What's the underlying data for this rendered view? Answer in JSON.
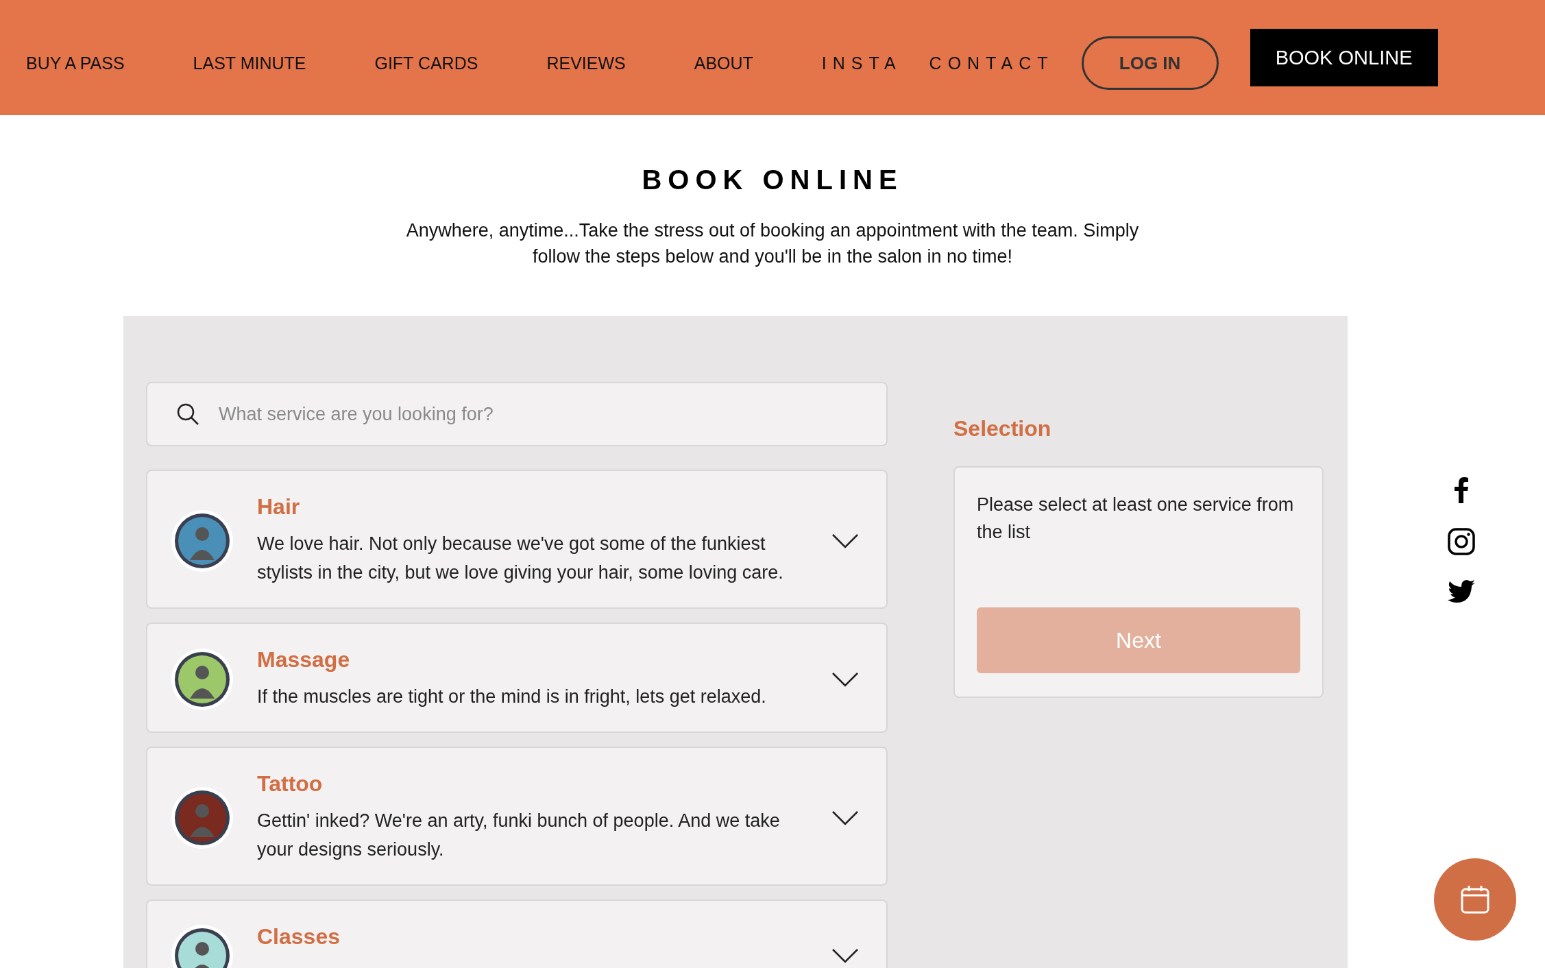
{
  "nav": {
    "links": [
      {
        "label": "BUY A PASS",
        "kind": "plain"
      },
      {
        "label": "LAST MINUTE",
        "kind": "plain"
      },
      {
        "label": "GIFT CARDS",
        "kind": "plain"
      },
      {
        "label": "REVIEWS",
        "kind": "plain"
      },
      {
        "label": "ABOUT",
        "kind": "plain"
      },
      {
        "label": "INSTA",
        "kind": "spaced"
      },
      {
        "label": "CONTACT",
        "kind": "spaced"
      }
    ],
    "login": "LOG IN",
    "book": "BOOK ONLINE"
  },
  "heading": "BOOK ONLINE",
  "intro": "Anywhere, anytime...Take the stress out of booking an appointment with the team. Simply follow the steps below and you'll be in the salon in no time!",
  "search": {
    "placeholder": "What service are you looking for?"
  },
  "services": [
    {
      "name": "Hair",
      "description": "We love hair. Not only because we've got some of the funkiest stylists in the city, but we love giving your hair, some loving care.",
      "color": "#4a8fb8"
    },
    {
      "name": "Massage",
      "description": "If the muscles are tight or the mind is in fright, lets get relaxed.",
      "color": "#9cc86a"
    },
    {
      "name": "Tattoo",
      "description": "Gettin' inked? We're an arty, funki bunch of people. And we take your designs seriously.",
      "color": "#7a2a1e"
    },
    {
      "name": "Classes",
      "color": "#a8dcd8"
    }
  ],
  "selection": {
    "title": "Selection",
    "message": "Please select at least one service from the list",
    "next": "Next"
  }
}
